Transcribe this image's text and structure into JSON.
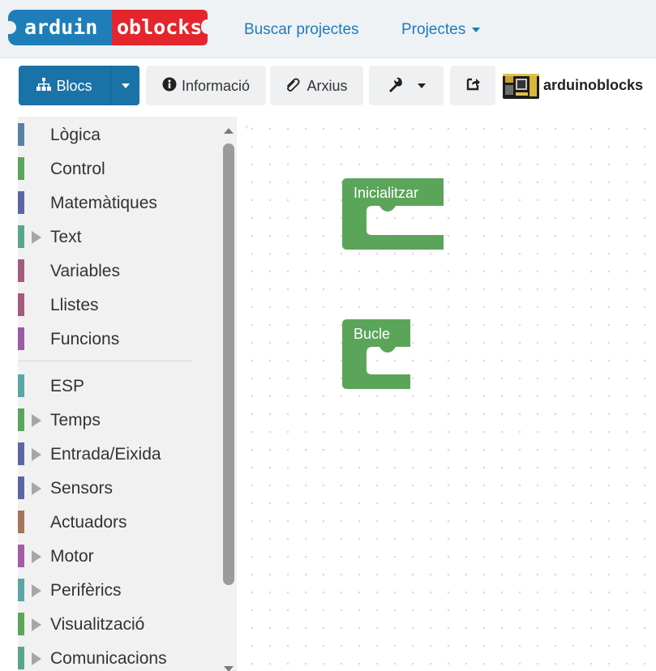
{
  "navbar": {
    "logo": {
      "part1": "arduin",
      "part2": "oblocks"
    },
    "search_link": "Buscar projectes",
    "projects_menu": "Projectes"
  },
  "toolbar": {
    "blocks_label": "Blocs",
    "info_label": "Informació",
    "files_label": "Arxius",
    "board_name": "arduinoblocks",
    "icons": [
      "sitemap-icon",
      "caret-down-icon",
      "info-circle-icon",
      "paperclip-icon",
      "wrench-icon",
      "share-icon",
      "board-icon"
    ]
  },
  "toolbox": {
    "categories": [
      {
        "label": "Lògica",
        "color": "#5b80a5",
        "expandable": false
      },
      {
        "label": "Control",
        "color": "#5ba55b",
        "expandable": false
      },
      {
        "label": "Matemàtiques",
        "color": "#5b67a5",
        "expandable": false
      },
      {
        "label": "Text",
        "color": "#5ba58c",
        "expandable": true
      },
      {
        "label": "Variables",
        "color": "#a55b80",
        "expandable": false
      },
      {
        "label": "Llistes",
        "color": "#a55b80",
        "expandable": false
      },
      {
        "label": "Funcions",
        "color": "#995ba5",
        "expandable": false
      },
      {
        "label": "ESP",
        "color": "#5ba5a5",
        "expandable": false
      },
      {
        "label": "Temps",
        "color": "#5ba55b",
        "expandable": true
      },
      {
        "label": "Entrada/Eixida",
        "color": "#5b67a5",
        "expandable": true
      },
      {
        "label": "Sensors",
        "color": "#5b67a5",
        "expandable": true
      },
      {
        "label": "Actuadors",
        "color": "#a5745b",
        "expandable": false
      },
      {
        "label": "Motor",
        "color": "#a55ba5",
        "expandable": true
      },
      {
        "label": "Perifèrics",
        "color": "#5ba5a5",
        "expandable": true
      },
      {
        "label": "Visualització",
        "color": "#5ba55b",
        "expandable": true
      },
      {
        "label": "Comunicacions",
        "color": "#5ba58c",
        "expandable": true
      }
    ]
  },
  "workspace": {
    "blocks": [
      {
        "label": "Inicialitzar",
        "color": "#5ba55b"
      },
      {
        "label": "Bucle",
        "color": "#5ba55b"
      }
    ]
  }
}
